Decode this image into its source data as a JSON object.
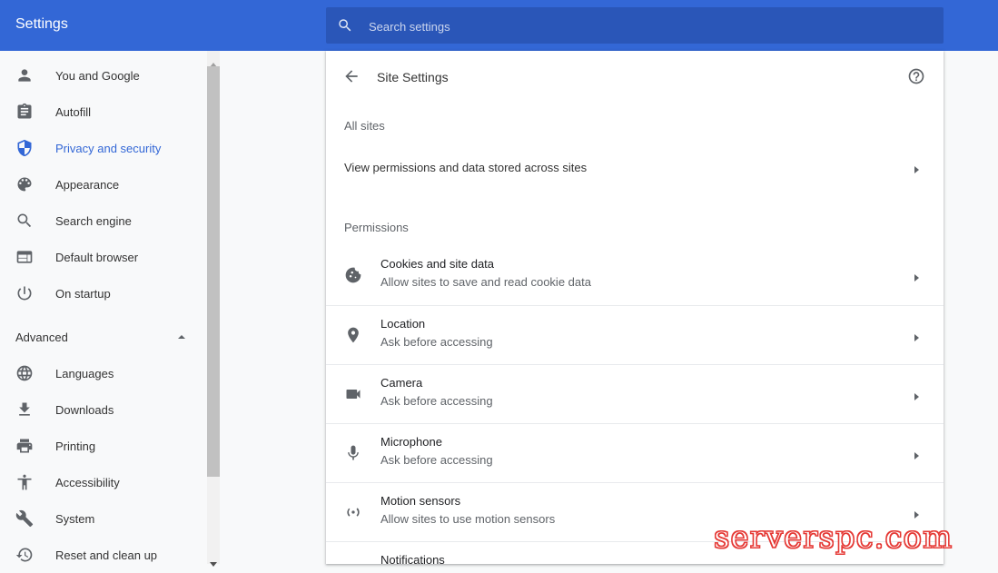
{
  "header": {
    "title": "Settings",
    "search_placeholder": "Search settings"
  },
  "sidebar": {
    "items": [
      {
        "label": "You and Google",
        "icon": "person-icon"
      },
      {
        "label": "Autofill",
        "icon": "clipboard-icon"
      },
      {
        "label": "Privacy and security",
        "icon": "shield-icon",
        "active": true
      },
      {
        "label": "Appearance",
        "icon": "palette-icon"
      },
      {
        "label": "Search engine",
        "icon": "search-icon"
      },
      {
        "label": "Default browser",
        "icon": "browser-icon"
      },
      {
        "label": "On startup",
        "icon": "power-icon"
      }
    ],
    "advanced_label": "Advanced",
    "advanced_items": [
      {
        "label": "Languages",
        "icon": "globe-icon"
      },
      {
        "label": "Downloads",
        "icon": "download-icon"
      },
      {
        "label": "Printing",
        "icon": "printer-icon"
      },
      {
        "label": "Accessibility",
        "icon": "accessibility-icon"
      },
      {
        "label": "System",
        "icon": "wrench-icon"
      },
      {
        "label": "Reset and clean up",
        "icon": "history-icon"
      }
    ]
  },
  "main": {
    "page_title": "Site Settings",
    "all_sites_heading": "All sites",
    "all_sites_link": "View permissions and data stored across sites",
    "permissions_heading": "Permissions",
    "permissions": [
      {
        "title": "Cookies and site data",
        "subtitle": "Allow sites to save and read cookie data",
        "icon": "cookie-icon"
      },
      {
        "title": "Location",
        "subtitle": "Ask before accessing",
        "icon": "location-pin-icon"
      },
      {
        "title": "Camera",
        "subtitle": "Ask before accessing",
        "icon": "camera-icon"
      },
      {
        "title": "Microphone",
        "subtitle": "Ask before accessing",
        "icon": "microphone-icon"
      },
      {
        "title": "Motion sensors",
        "subtitle": "Allow sites to use motion sensors",
        "icon": "motion-sensor-icon"
      },
      {
        "title": "Notifications",
        "subtitle": "",
        "icon": "bell-icon"
      }
    ]
  },
  "colors": {
    "accent": "#3367d6",
    "header_bg": "#3367d6",
    "search_bg": "#2a56b8"
  },
  "watermark": "serverspc.com"
}
